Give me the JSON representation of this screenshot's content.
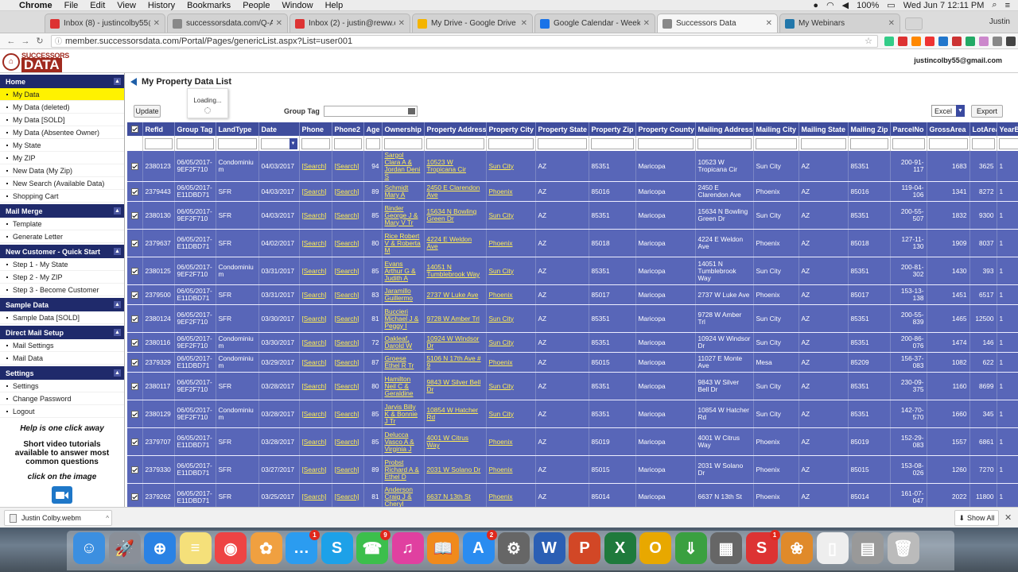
{
  "menubar": {
    "items": [
      "Chrome",
      "File",
      "Edit",
      "View",
      "History",
      "Bookmarks",
      "People",
      "Window",
      "Help"
    ],
    "datetime": "Wed Jun 7  12:11 PM",
    "battery": "100%"
  },
  "tabs": [
    {
      "label": "Inbox (8) - justincolby55@gma",
      "icon": "gmail-icon",
      "color": "#d33"
    },
    {
      "label": "successorsdata.com/Q-A-Blo",
      "icon": "page-icon",
      "color": "#888"
    },
    {
      "label": "Inbox (2) - justin@reww.com",
      "icon": "gmail-icon",
      "color": "#d33"
    },
    {
      "label": "My Drive - Google Drive",
      "icon": "drive-icon",
      "color": "#f4b400"
    },
    {
      "label": "Google Calendar - Week of Ju",
      "icon": "calendar-icon",
      "color": "#1a73e8"
    },
    {
      "label": "Successors Data",
      "icon": "page-icon",
      "color": "#888",
      "active": true
    },
    {
      "label": "My Webinars",
      "icon": "webinar-icon",
      "color": "#27a"
    }
  ],
  "profile_name": "Justin",
  "url": "member.successorsdata.com/Portal/Pages/genericList.aspx?List=user001",
  "logo": {
    "top": "SUCCESSORS",
    "bottom": "DATA"
  },
  "user_email": "justincolby55@gmail.com",
  "sidebar": [
    {
      "title": "Home",
      "items": [
        "My Data",
        "My Data (deleted)",
        "My Data [SOLD]",
        "My Data (Absentee Owner)",
        "My State",
        "My ZIP",
        "New Data (My Zip)",
        "New Search (Available Data)",
        "Shopping Cart"
      ]
    },
    {
      "title": "Mail Merge",
      "items": [
        "Template",
        "Generate Letter"
      ]
    },
    {
      "title": "New Customer - Quick Start",
      "items": [
        "Step 1 - My State",
        "Step 2 - My ZIP",
        "Step 3 - Become Customer"
      ]
    },
    {
      "title": "Sample Data",
      "items": [
        "Sample Data [SOLD]"
      ]
    },
    {
      "title": "Direct Mail Setup",
      "items": [
        "Mail Settings",
        "Mail Data"
      ]
    },
    {
      "title": "Settings",
      "items": [
        "Settings",
        "Change Password",
        "Logout"
      ]
    }
  ],
  "help": {
    "line1": "Help is one click away",
    "line2": "Short video tutorials available to answer most common questions",
    "line3": "click on the image"
  },
  "page_title": "My Property Data List",
  "toolbar": {
    "update": "Update",
    "group_tag_label": "Group Tag",
    "export_format": "Excel",
    "export": "Export"
  },
  "loading_text": "Loading...",
  "table": {
    "columns": [
      "",
      "RefId",
      "Group Tag",
      "LandType",
      "Date",
      "Phone",
      "Phone2",
      "Age",
      "Ownership",
      "Property Address",
      "Property City",
      "Property State",
      "Property Zip",
      "Property County",
      "Mailing Address",
      "Mailing City",
      "Mailing State",
      "Mailing Zip",
      "ParcelNo",
      "GrossArea",
      "LotArea",
      "YearB"
    ],
    "rows": [
      [
        "2380123",
        "06/05/2017-9EF2F710",
        "Condominium",
        "04/03/2017",
        "[Search]",
        "[Search]",
        "94",
        "Sargol Clara A & Jordan Deni S",
        "10523 W Tropicana Cir",
        "Sun City",
        "AZ",
        "85351",
        "Maricopa",
        "10523 W Tropicana Cir",
        "Sun City",
        "AZ",
        "85351",
        "200-91-117",
        "1683",
        "3625",
        "1"
      ],
      [
        "2379443",
        "06/05/2017-E11DBD71",
        "SFR",
        "04/03/2017",
        "[Search]",
        "[Search]",
        "89",
        "Schmidt Mary A",
        "2450 E Clarendon Ave",
        "Phoenix",
        "AZ",
        "85016",
        "Maricopa",
        "2450 E Clarendon Ave",
        "Phoenix",
        "AZ",
        "85016",
        "119-04-106",
        "1341",
        "8272",
        "1"
      ],
      [
        "2380130",
        "06/05/2017-9EF2F710",
        "SFR",
        "04/03/2017",
        "[Search]",
        "[Search]",
        "85",
        "Binder George J & Mary V Tr",
        "15634 N Bowling Green Dr",
        "Sun City",
        "AZ",
        "85351",
        "Maricopa",
        "15634 N Bowling Green Dr",
        "Sun City",
        "AZ",
        "85351",
        "200-55-507",
        "1832",
        "9300",
        "1"
      ],
      [
        "2379637",
        "06/05/2017-E11DBD71",
        "SFR",
        "04/02/2017",
        "[Search]",
        "[Search]",
        "80",
        "Rice Robert V & Roberta M",
        "4224 E Weldon Ave",
        "Phoenix",
        "AZ",
        "85018",
        "Maricopa",
        "4224 E Weldon Ave",
        "Phoenix",
        "AZ",
        "85018",
        "127-11-130",
        "1909",
        "8037",
        "1"
      ],
      [
        "2380125",
        "06/05/2017-9EF2F710",
        "Condominium",
        "03/31/2017",
        "[Search]",
        "[Search]",
        "85",
        "Evans Arthur G & Judith A",
        "14051 N Tumblebrook Way",
        "Sun City",
        "AZ",
        "85351",
        "Maricopa",
        "14051 N Tumblebrook Way",
        "Sun City",
        "AZ",
        "85351",
        "200-81-302",
        "1430",
        "393",
        "1"
      ],
      [
        "2379500",
        "06/05/2017-E11DBD71",
        "SFR",
        "03/31/2017",
        "[Search]",
        "[Search]",
        "83",
        "Jaramillo Guillermo",
        "2737 W Luke Ave",
        "Phoenix",
        "AZ",
        "85017",
        "Maricopa",
        "2737 W Luke Ave",
        "Phoenix",
        "AZ",
        "85017",
        "153-13-138",
        "1451",
        "6517",
        "1"
      ],
      [
        "2380124",
        "06/05/2017-9EF2F710",
        "SFR",
        "03/30/2017",
        "[Search]",
        "[Search]",
        "81",
        "Buccieri Michael J & Peggy I",
        "9728 W Amber Trl",
        "Sun City",
        "AZ",
        "85351",
        "Maricopa",
        "9728 W Amber Trl",
        "Sun City",
        "AZ",
        "85351",
        "200-55-839",
        "1465",
        "12500",
        "1"
      ],
      [
        "2380116",
        "06/05/2017-9EF2F710",
        "Condominium",
        "03/30/2017",
        "[Search]",
        "[Search]",
        "72",
        "Oakleaf, Darold W",
        "10924 W Windsor Dr",
        "Sun City",
        "AZ",
        "85351",
        "Maricopa",
        "10924 W Windsor Dr",
        "Sun City",
        "AZ",
        "85351",
        "200-86-076",
        "1474",
        "146",
        "1"
      ],
      [
        "2379329",
        "06/05/2017-E11DBD71",
        "Condominium",
        "03/29/2017",
        "[Search]",
        "[Search]",
        "87",
        "Groese Ethel R Tr",
        "5106 N 17th Ave # 9",
        "Phoenix",
        "AZ",
        "85015",
        "Maricopa",
        "11027 E Monte Ave",
        "Mesa",
        "AZ",
        "85209",
        "156-37-083",
        "1082",
        "622",
        "1"
      ],
      [
        "2380117",
        "06/05/2017-9EF2F710",
        "SFR",
        "03/28/2017",
        "[Search]",
        "[Search]",
        "80",
        "Hamilton Neil C & Geraldine",
        "9843 W Silver Bell Dr",
        "Sun City",
        "AZ",
        "85351",
        "Maricopa",
        "9843 W Silver Bell Dr",
        "Sun City",
        "AZ",
        "85351",
        "230-09-375",
        "1160",
        "8699",
        "1"
      ],
      [
        "2380129",
        "06/05/2017-9EF2F710",
        "Condominium",
        "03/28/2017",
        "[Search]",
        "[Search]",
        "85",
        "Jarvis Billy K & Bonnie J Tr",
        "10854 W Hatcher Rd",
        "Sun City",
        "AZ",
        "85351",
        "Maricopa",
        "10854 W Hatcher Rd",
        "Sun City",
        "AZ",
        "85351",
        "142-70-570",
        "1660",
        "345",
        "1"
      ],
      [
        "2379707",
        "06/05/2017-E11DBD71",
        "SFR",
        "03/28/2017",
        "[Search]",
        "[Search]",
        "85",
        "Delucca Vasco A & Virginia J",
        "4001 W Citrus Way",
        "Phoenix",
        "AZ",
        "85019",
        "Maricopa",
        "4001 W Citrus Way",
        "Phoenix",
        "AZ",
        "85019",
        "152-29-083",
        "1557",
        "6861",
        "1"
      ],
      [
        "2379330",
        "06/05/2017-E11DBD71",
        "SFR",
        "03/27/2017",
        "[Search]",
        "[Search]",
        "89",
        "Probst Richard A & Ethel D",
        "2031 W Solano Dr",
        "Phoenix",
        "AZ",
        "85015",
        "Maricopa",
        "2031 W Solano Dr",
        "Phoenix",
        "AZ",
        "85015",
        "153-08-026",
        "1260",
        "7270",
        "1"
      ],
      [
        "2379262",
        "06/05/2017-E11DBD71",
        "SFR",
        "03/25/2017",
        "[Search]",
        "[Search]",
        "81",
        "Anderson Craig J & Cheryl",
        "6637 N 13th St",
        "Phoenix",
        "AZ",
        "85014",
        "Maricopa",
        "6637 N 13th St",
        "Phoenix",
        "AZ",
        "85014",
        "161-07-047",
        "2022",
        "11800",
        "1"
      ]
    ]
  },
  "download": {
    "filename": "Justin Colby.webm",
    "show_all": "Show All"
  },
  "dock": [
    {
      "name": "finder-icon",
      "color": "#3c8fe0",
      "glyph": "☺"
    },
    {
      "name": "launchpad-icon",
      "color": "#8a8f98",
      "glyph": "🚀"
    },
    {
      "name": "safari-icon",
      "color": "#2a82e4",
      "glyph": "⊕"
    },
    {
      "name": "notes-icon",
      "color": "#f5e07a",
      "glyph": "≡"
    },
    {
      "name": "chrome-icon",
      "color": "#e44",
      "glyph": "◉"
    },
    {
      "name": "photos-icon",
      "color": "#f0a040",
      "glyph": "✿"
    },
    {
      "name": "messages-icon",
      "color": "#2b9cf0",
      "glyph": "…",
      "badge": "1"
    },
    {
      "name": "skype-icon",
      "color": "#1da1e8",
      "glyph": "S"
    },
    {
      "name": "facetime-icon",
      "color": "#3cbf4c",
      "glyph": "☎",
      "badge": "9"
    },
    {
      "name": "itunes-icon",
      "color": "#e040a0",
      "glyph": "♫"
    },
    {
      "name": "ibooks-icon",
      "color": "#f08a1c",
      "glyph": "📖"
    },
    {
      "name": "appstore-icon",
      "color": "#2a8cf0",
      "glyph": "A",
      "badge": "2"
    },
    {
      "name": "system-preferences-icon",
      "color": "#666",
      "glyph": "⚙"
    },
    {
      "name": "word-icon",
      "color": "#2b5fb4",
      "glyph": "W"
    },
    {
      "name": "powerpoint-icon",
      "color": "#d24726",
      "glyph": "P"
    },
    {
      "name": "excel-icon",
      "color": "#1f7a3c",
      "glyph": "X"
    },
    {
      "name": "outlook-icon",
      "color": "#e8a800",
      "glyph": "O"
    },
    {
      "name": "install-icon",
      "color": "#3aa040",
      "glyph": "⇓"
    },
    {
      "name": "calculator-icon",
      "color": "#666",
      "glyph": "▦"
    },
    {
      "name": "sheet-app-icon",
      "color": "#d33",
      "glyph": "S",
      "badge": "1"
    },
    {
      "name": "flower-app-icon",
      "color": "#e08a2a",
      "glyph": "❀"
    },
    {
      "name": "document-icon",
      "color": "#eee",
      "glyph": "▯"
    },
    {
      "name": "files-icon",
      "color": "#999",
      "glyph": "▤"
    },
    {
      "name": "trash-icon",
      "color": "#bbb",
      "glyph": "🗑"
    }
  ]
}
